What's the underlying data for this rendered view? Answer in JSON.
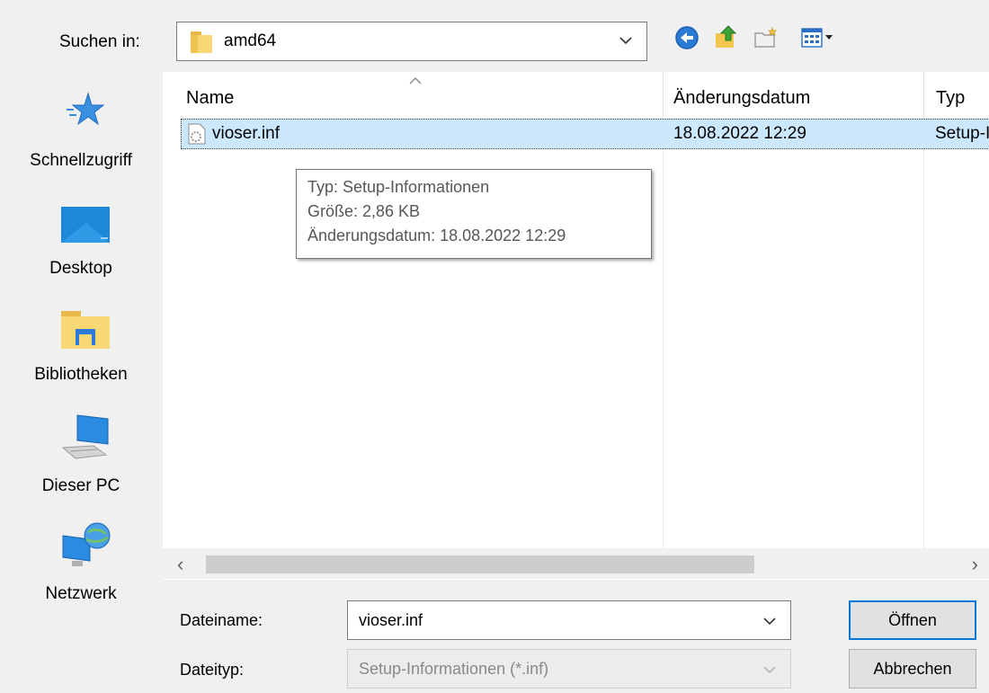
{
  "lookin": {
    "label": "Suchen in:",
    "value": "amd64"
  },
  "places": [
    {
      "label": "Schnellzugriff"
    },
    {
      "label": "Desktop"
    },
    {
      "label": "Bibliotheken"
    },
    {
      "label": "Dieser PC"
    },
    {
      "label": "Netzwerk"
    }
  ],
  "columns": {
    "name": "Name",
    "date": "Änderungsdatum",
    "type": "Typ"
  },
  "file": {
    "name": "vioser.inf",
    "date": "18.08.2022 12:29",
    "type": "Setup-Informationen"
  },
  "tooltip": {
    "line1": "Typ: Setup-Informationen",
    "line2": "Größe: 2,86 KB",
    "line3": "Änderungsdatum: 18.08.2022 12:29"
  },
  "filename": {
    "label": "Dateiname:",
    "value": "vioser.inf"
  },
  "filetype": {
    "label": "Dateityp:",
    "value": "Setup-Informationen (*.inf)"
  },
  "buttons": {
    "open": "Öffnen",
    "cancel": "Abbrechen"
  },
  "colors": {
    "selection": "#cce8ff",
    "accent": "#0078d7",
    "folder": "#f8d775"
  }
}
